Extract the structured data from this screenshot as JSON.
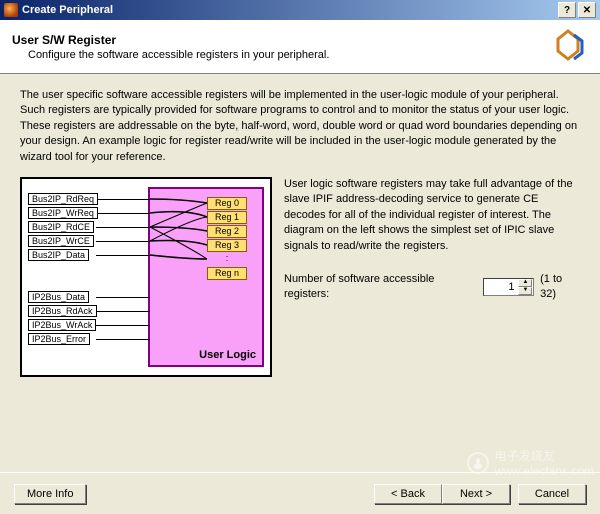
{
  "window": {
    "title": "Create Peripheral"
  },
  "header": {
    "title": "User S/W Register",
    "subtitle": "Configure the software accessible registers in your peripheral."
  },
  "intro": "The user specific software accessible registers will be implemented in the user-logic module of your peripheral. Such registers are typically provided for software programs to control and to monitor the status of your user logic. These registers are addressable on the byte, half-word, word, double word or quad word boundaries depending on your design. An example logic for register read/write will be included in the user-logic module generated by the wizard tool for your reference.",
  "diagram": {
    "signals_top": [
      "Bus2IP_RdReq",
      "Bus2IP_WrReq",
      "Bus2IP_RdCE",
      "Bus2IP_WrCE",
      "Bus2IP_Data"
    ],
    "signals_bottom": [
      "IP2Bus_Data",
      "IP2Bus_RdAck",
      "IP2Bus_WrAck",
      "IP2Bus_Error"
    ],
    "regs": [
      "Reg 0",
      "Reg 1",
      "Reg 2",
      "Reg 3",
      ":",
      "Reg n"
    ],
    "logic_label": "User Logic"
  },
  "right": {
    "text": "User logic software registers may take full advantage of the slave IPIF address-decoding service to generate CE decodes for all of the individual register of interest. The diagram on the left shows the simplest set of IPIC slave signals to read/write the registers.",
    "count_label": "Number of software accessible registers:",
    "count_value": "1",
    "count_range": "(1 to 32)"
  },
  "footer": {
    "more": "More Info",
    "back": "< Back",
    "next": "Next >",
    "cancel": "Cancel"
  },
  "watermark": "电子发烧友\nwww.elecfans.com"
}
